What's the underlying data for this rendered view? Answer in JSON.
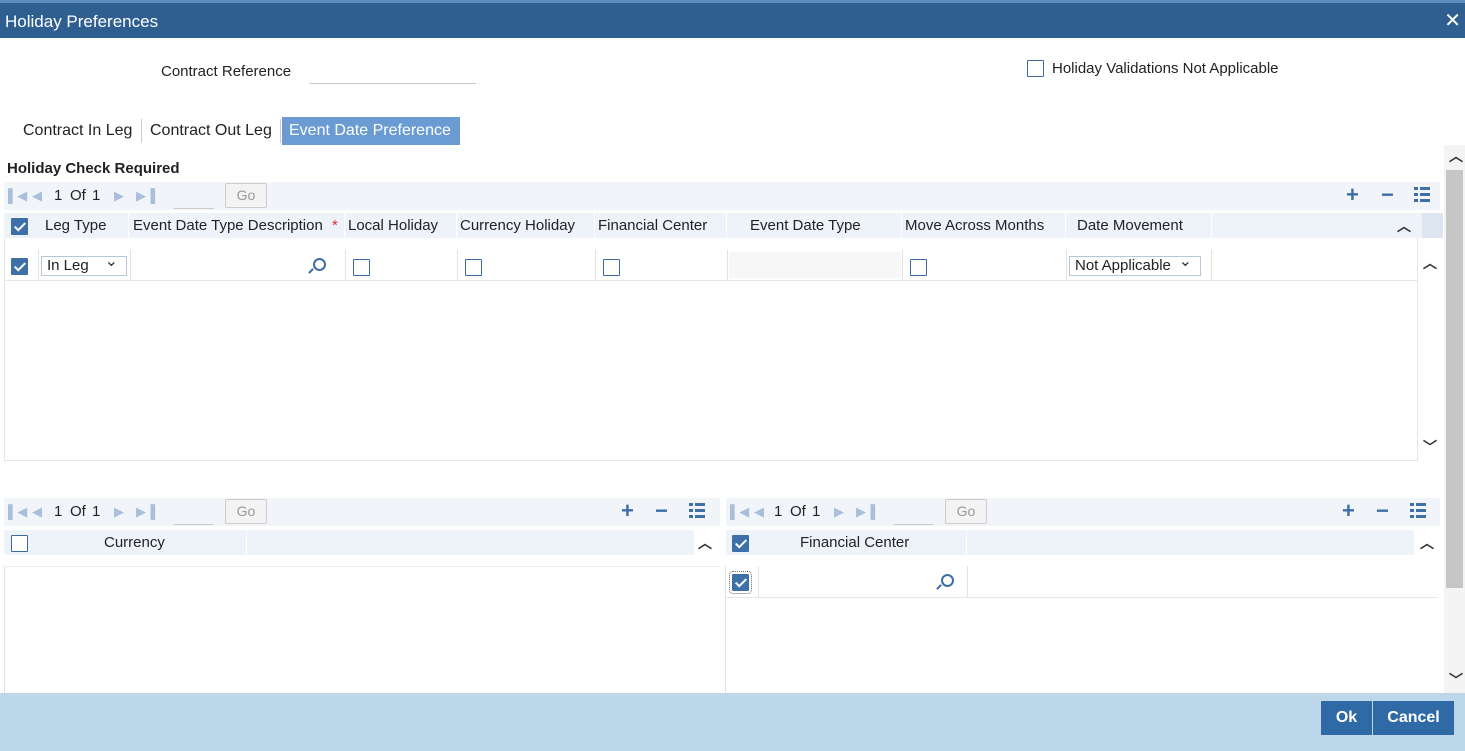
{
  "window": {
    "title": "Holiday Preferences",
    "close_glyph": "✕"
  },
  "header": {
    "contract_reference_label": "Contract Reference",
    "contract_reference_value": "",
    "holiday_validations_label": "Holiday Validations Not Applicable",
    "holiday_validations_checked": false
  },
  "tabs": [
    {
      "label": "Contract In Leg",
      "active": false
    },
    {
      "label": "Contract Out Leg",
      "active": false
    },
    {
      "label": "Event Date Preference",
      "active": true
    }
  ],
  "section": {
    "title": "Holiday Check Required"
  },
  "main_grid": {
    "pager": {
      "current": "1",
      "of_label": "Of",
      "total": "1",
      "go_label": "Go"
    },
    "columns": [
      "Leg Type",
      "Event Date Type Description",
      "Local Holiday",
      "Currency Holiday",
      "Financial Center",
      "Event Date Type",
      "Move Across Months",
      "Date Movement"
    ],
    "required_marker": "*",
    "rows": [
      {
        "selected": true,
        "leg_type": "In Leg",
        "event_date_type_description": "",
        "local_holiday": false,
        "currency_holiday": false,
        "financial_center": false,
        "event_date_type": "",
        "move_across_months": false,
        "date_movement": "Not Applicable"
      }
    ]
  },
  "currency_grid": {
    "pager": {
      "current": "1",
      "of_label": "Of",
      "total": "1",
      "go_label": "Go"
    },
    "columns": [
      "Currency"
    ],
    "rows": []
  },
  "financial_center_grid": {
    "pager": {
      "current": "1",
      "of_label": "Of",
      "total": "1",
      "go_label": "Go"
    },
    "columns": [
      "Financial Center"
    ],
    "rows": [
      {
        "selected": true,
        "financial_center": ""
      }
    ]
  },
  "icons": {
    "first": "first-page-icon",
    "prev": "previous-page-icon",
    "next": "next-page-icon",
    "last": "last-page-icon",
    "add": "add-row-icon",
    "remove": "delete-row-icon",
    "list": "single-view-icon",
    "lookup": "search-icon"
  },
  "footer": {
    "ok_label": "Ok",
    "cancel_label": "Cancel"
  },
  "colors": {
    "titlebar": "#2f5f91",
    "accent": "#3d6fa8",
    "active_tab": "#6a9bd2",
    "footer": "#bcd7ea"
  }
}
